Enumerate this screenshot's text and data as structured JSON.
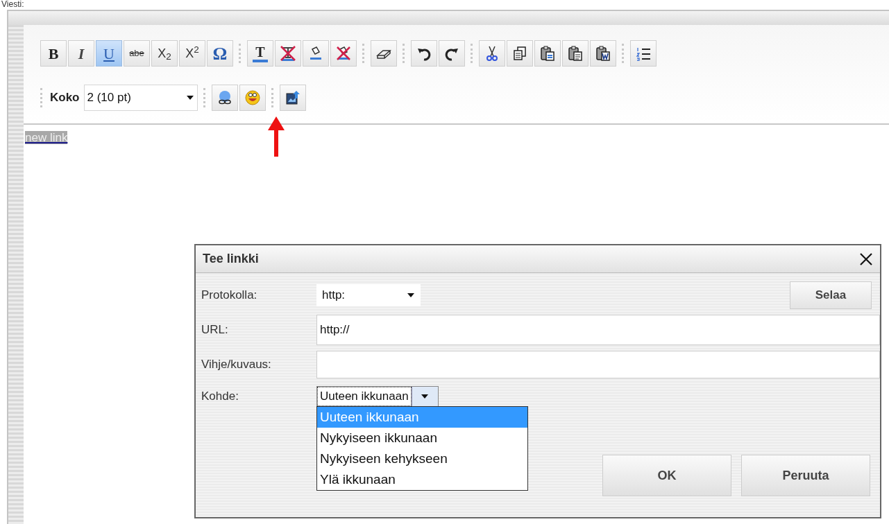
{
  "heading": "Viesti:",
  "toolbar_1": [
    [
      {
        "kind": "text",
        "label": "B",
        "active": false
      },
      {
        "kind": "text",
        "label": "I",
        "active": false
      },
      {
        "kind": "text",
        "label": "U",
        "active": true
      },
      {
        "kind": "text",
        "label": "abe",
        "active": false
      },
      {
        "kind": "text",
        "label": "X$_{2}$",
        "active": false
      },
      {
        "kind": "text",
        "label": "X$^{2}$",
        "active": false
      },
      {
        "kind": "text",
        "label": "Ω",
        "active": false
      }
    ],
    [
      {
        "kind": "color",
        "label": "T",
        "active": false
      },
      {
        "kind": "color-remove",
        "active": false
      },
      {
        "kind": "fill",
        "active": false
      },
      {
        "kind": "fill-remove",
        "active": false
      }
    ],
    [
      {
        "kind": "eraser",
        "active": false
      }
    ],
    [
      {
        "kind": "undo",
        "active": false
      },
      {
        "kind": "redo",
        "active": false
      }
    ],
    [
      {
        "kind": "cut",
        "active": false
      },
      {
        "kind": "copy",
        "active": false
      },
      {
        "kind": "paste",
        "active": false
      },
      {
        "kind": "paste-text",
        "active": false
      },
      {
        "kind": "paste-word",
        "active": false
      }
    ],
    [
      {
        "kind": "list",
        "active": false
      }
    ]
  ],
  "size": {
    "label": "Koko",
    "value": "2 (10 pt)"
  },
  "toolbar_2": [
    [
      {
        "kind": "link",
        "active": false
      },
      {
        "kind": "smiley",
        "active": false
      }
    ],
    [
      {
        "kind": "image",
        "active": false
      }
    ]
  ],
  "content": {
    "text": "new link",
    "selected": true
  },
  "dialog": {
    "title": "Tee linkki",
    "protocol": {
      "label": "Protokolla:",
      "value": "http:"
    },
    "browse": "Selaa",
    "url": {
      "label": "URL:",
      "value": "http://"
    },
    "hint": {
      "label": "Vihje/kuvaus:"
    },
    "target": {
      "label": "Kohde:",
      "value": "Uuteen ikkunaan",
      "expanded": true,
      "options": [
        {
          "label": "Uuteen ikkunaan",
          "selected": true
        },
        {
          "label": "Nykyiseen ikkunaan",
          "selected": false
        },
        {
          "label": "Nykyiseen kehykseen",
          "selected": false
        },
        {
          "label": "Ylä ikkunaan",
          "selected": false
        }
      ]
    },
    "buttons": [
      "OK",
      "Peruuta"
    ]
  }
}
